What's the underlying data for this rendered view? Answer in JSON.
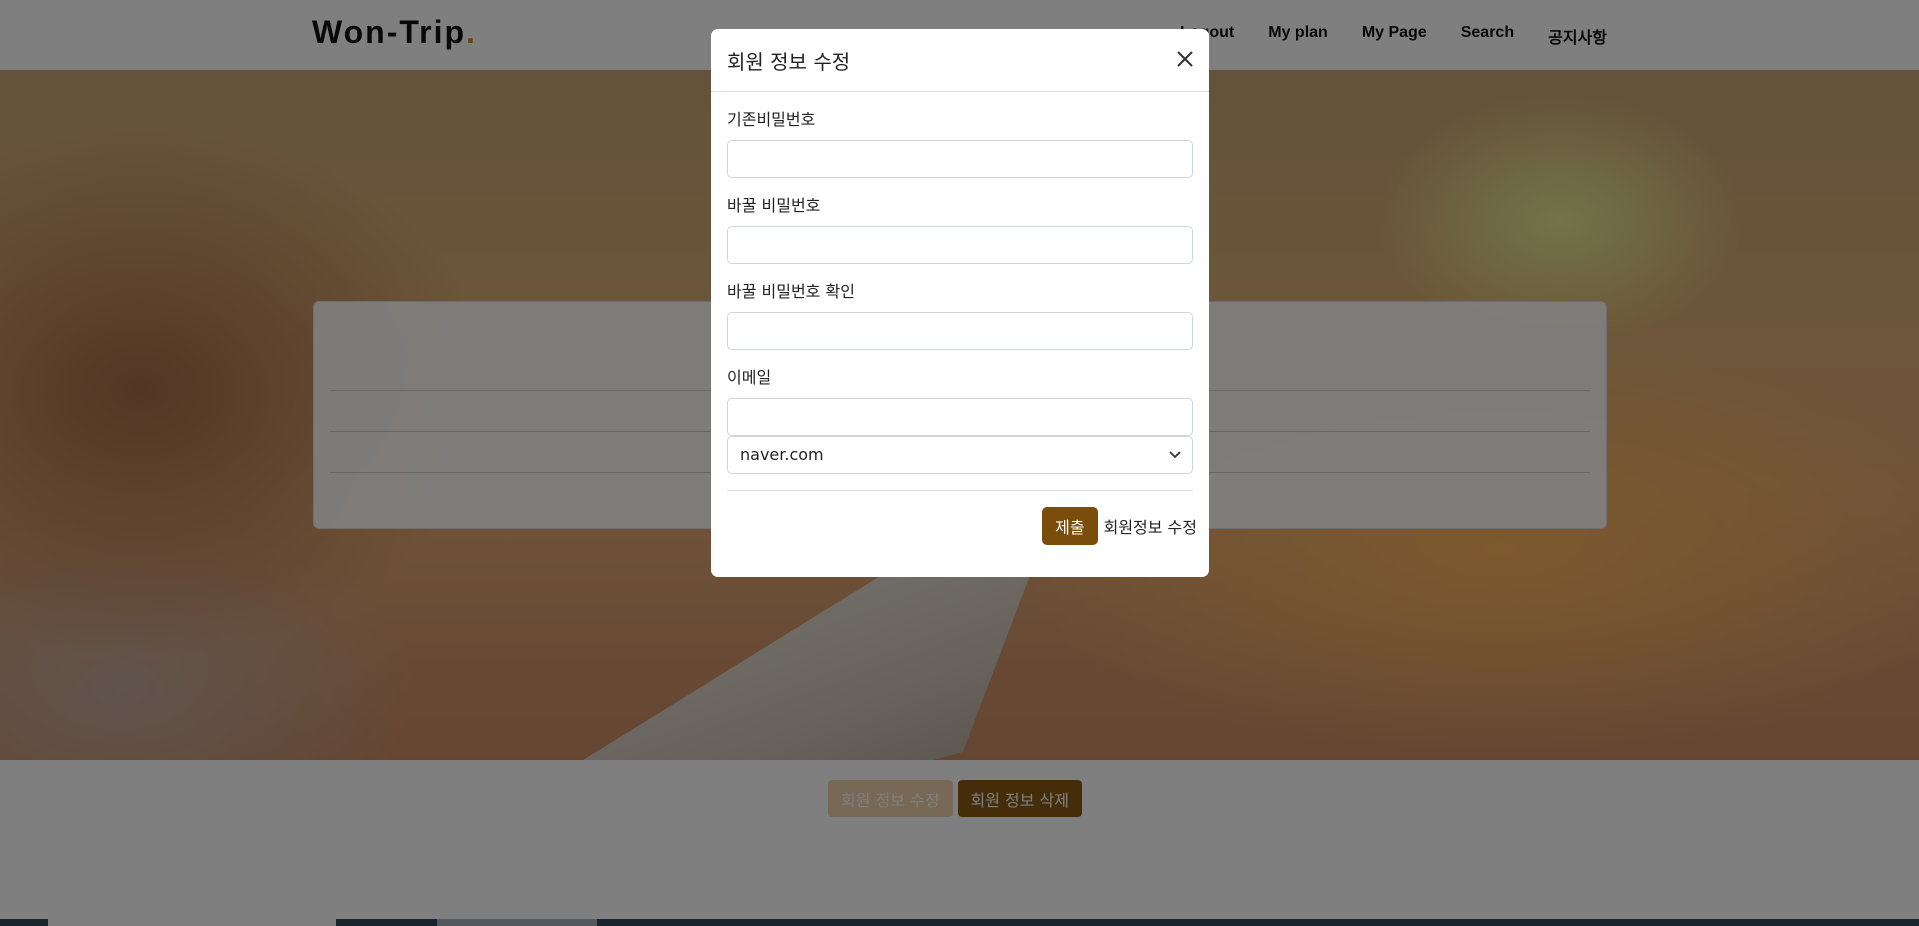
{
  "brand": {
    "name": "Won-Trip",
    "dot": "."
  },
  "nav": [
    "Logout",
    "My plan",
    "My Page",
    "Search",
    "공지사항"
  ],
  "page_buttons": {
    "edit_label": "회원 정보 수정",
    "delete_label": "회원 정보 삭제"
  },
  "modal": {
    "title": "회원 정보 수정",
    "fields": {
      "current_password": {
        "label": "기존비밀번호",
        "value": ""
      },
      "new_password": {
        "label": "바꿀 비밀번호",
        "value": ""
      },
      "confirm_password": {
        "label": "바꿀 비밀번호 확인",
        "value": ""
      },
      "email": {
        "label": "이메일",
        "value": "",
        "domain": "naver.com"
      }
    },
    "submit_label": "제출",
    "edit_link": "회원정보 수정"
  },
  "colors": {
    "accent": "#7a4d0a",
    "brand_dot": "#d38a1e"
  }
}
